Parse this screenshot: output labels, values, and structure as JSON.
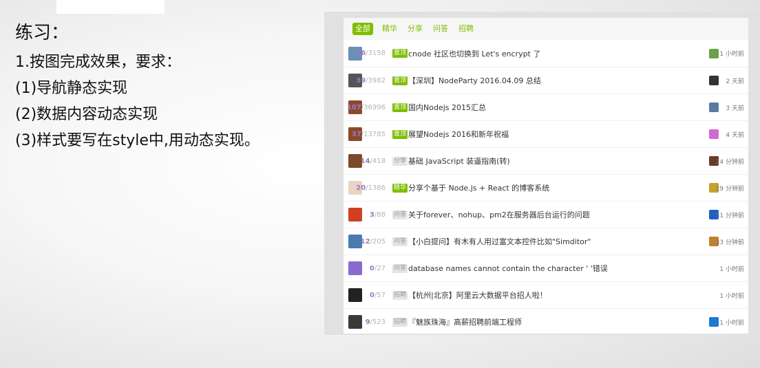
{
  "slide": {
    "title": "练习：",
    "lines": [
      "1.按图完成效果，要求：",
      "(1)导航静态实现",
      "(2)数据内容动态实现",
      "(3)样式要写在style中,用动态实现。"
    ]
  },
  "tabs": [
    "全部",
    "精华",
    "分享",
    "问答",
    "招聘"
  ],
  "active_tab": "全部",
  "colors": {
    "accent": "#80bd01",
    "reply": "#9e78c0",
    "muted": "#b4b4b4"
  },
  "topics": [
    {
      "replies": "36",
      "views": "3158",
      "tag": "置顶",
      "pinned": true,
      "title": "cnode 社区也切换到 Let's encrypt 了",
      "time": "1 小时前",
      "avatar_color": "#6b8fb5",
      "reply_avatar_color": "#6aa04c"
    },
    {
      "replies": "39",
      "views": "3982",
      "tag": "置顶",
      "pinned": true,
      "title": "【深圳】NodeParty 2016.04.09 总结",
      "time": "2 天前",
      "avatar_color": "#555555",
      "reply_avatar_color": "#333333"
    },
    {
      "replies": "107",
      "views": "36996",
      "tag": "置顶",
      "pinned": true,
      "title": "国内Nodejs 2015汇总",
      "time": "3 天前",
      "avatar_color": "#8a4a2a",
      "reply_avatar_color": "#5a7aa0"
    },
    {
      "replies": "37",
      "views": "13785",
      "tag": "置顶",
      "pinned": true,
      "title": "展望Nodejs 2016和新年祝福",
      "time": "4 天前",
      "avatar_color": "#8a4a2a",
      "reply_avatar_color": "#d06ad0"
    },
    {
      "replies": "14",
      "views": "418",
      "tag": "分享",
      "pinned": false,
      "title": "基础 JavaScript 装逼指南(转)",
      "time": "24 分钟前",
      "avatar_color": "#7a4a2a",
      "reply_avatar_color": "#6a3a2a"
    },
    {
      "replies": "20",
      "views": "1386",
      "tag": "精华",
      "pinned": true,
      "title": "分享个基于 Node.js + React 的博客系统",
      "time": "29 分钟前",
      "avatar_color": "#e8d4c0",
      "reply_avatar_color": "#c8a030"
    },
    {
      "replies": "3",
      "views": "88",
      "tag": "问答",
      "pinned": false,
      "title": "关于forever、nohup、pm2在服务器后台运行的问题",
      "time": "31 分钟前",
      "avatar_color": "#d04020",
      "reply_avatar_color": "#2060c0"
    },
    {
      "replies": "12",
      "views": "205",
      "tag": "问答",
      "pinned": false,
      "title": "【小白提问】有木有人用过富文本控件比如\"Simditor\"",
      "time": "33 分钟前",
      "avatar_color": "#4a7ab0",
      "reply_avatar_color": "#c08030"
    },
    {
      "replies": "0",
      "views": "27",
      "tag": "问答",
      "pinned": false,
      "title": "database names cannot contain the character ' '错误",
      "time": "1 小时前",
      "avatar_color": "#8a6ad0",
      "reply_avatar_color": ""
    },
    {
      "replies": "0",
      "views": "57",
      "tag": "招聘",
      "pinned": false,
      "title": "【杭州|北京】阿里云大数据平台招人啦！",
      "time": "1 小时前",
      "avatar_color": "#222222",
      "reply_avatar_color": ""
    },
    {
      "replies": "9",
      "views": "523",
      "tag": "招聘",
      "pinned": false,
      "title": "『魅族珠海』高薪招聘前端工程师",
      "time": "1 小时前",
      "avatar_color": "#3a3a3a",
      "reply_avatar_color": "#1a7ad0"
    }
  ]
}
